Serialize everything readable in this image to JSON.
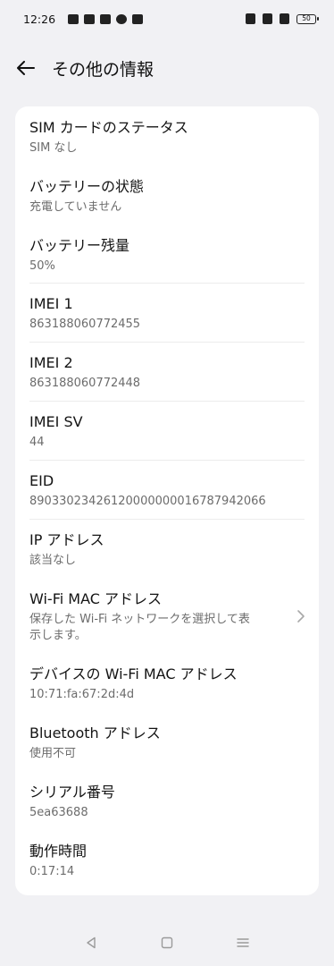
{
  "status": {
    "time": "12:26",
    "battery": "50"
  },
  "header": {
    "title": "その他の情報"
  },
  "items": [
    {
      "title": "SIM カードのステータス",
      "value": "SIM なし"
    },
    {
      "title": "バッテリーの状態",
      "value": "充電していません"
    },
    {
      "title": "バッテリー残量",
      "value": "50%"
    },
    {
      "title": "IMEI 1",
      "value": "863188060772455"
    },
    {
      "title": "IMEI 2",
      "value": "863188060772448"
    },
    {
      "title": "IMEI SV",
      "value": "44"
    },
    {
      "title": "EID",
      "value": "89033023426120000000016787942066"
    },
    {
      "title": "IP アドレス",
      "value": "該当なし"
    },
    {
      "title": "Wi-Fi MAC アドレス",
      "value_line1": "保存した Wi-Fi ネットワークを選択して表",
      "value_line2": "示します。"
    },
    {
      "title": "デバイスの Wi-Fi MAC アドレス",
      "value": "10:71:fa:67:2d:4d"
    },
    {
      "title": "Bluetooth アドレス",
      "value": "使用不可"
    },
    {
      "title": "シリアル番号",
      "value": "5ea63688"
    },
    {
      "title": "動作時間",
      "value": "0:17:14"
    }
  ]
}
